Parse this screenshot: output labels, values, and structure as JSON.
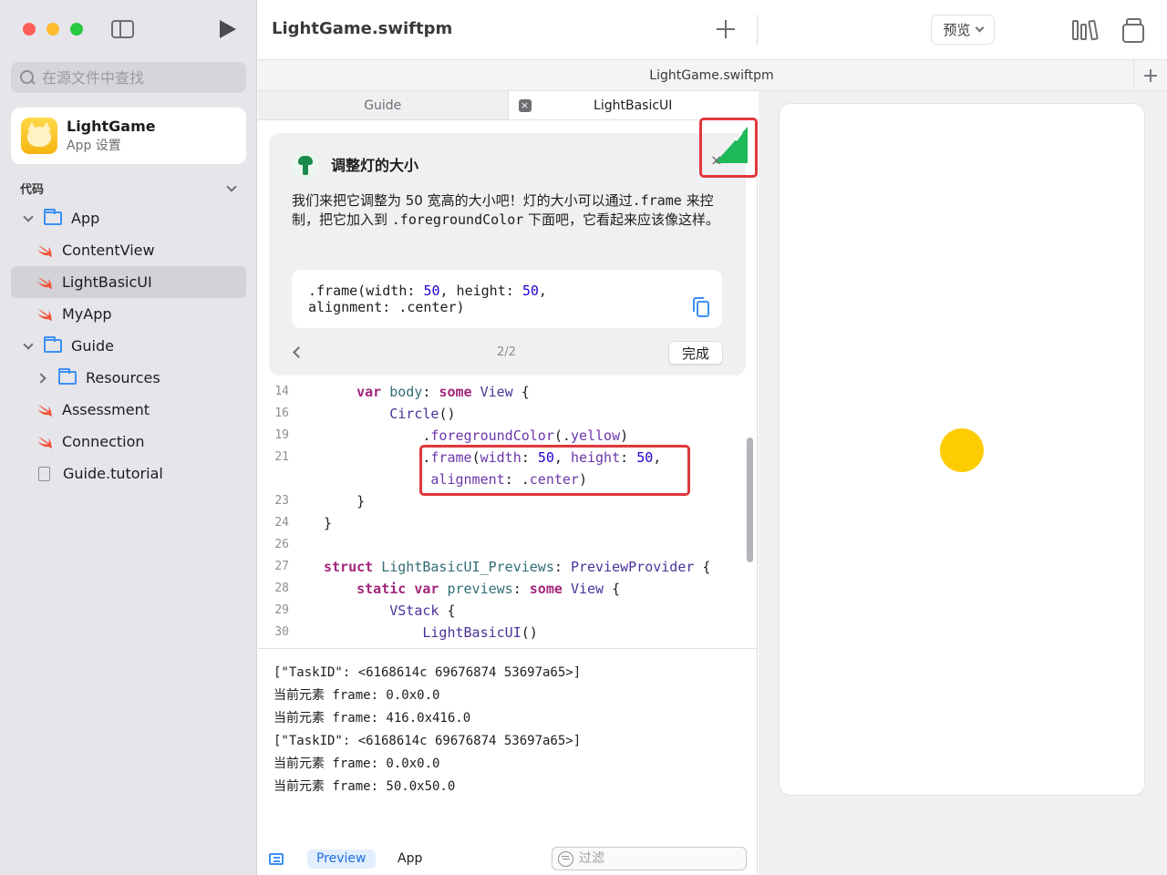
{
  "window": {
    "traffic_lights": {
      "close": "#fe5f57",
      "minimize": "#febc2e",
      "zoom": "#28c840"
    }
  },
  "sidebar": {
    "search_placeholder": "在源文件中查找",
    "app_card": {
      "name": "LightGame",
      "subtitle": "App 设置"
    },
    "section_title": "代码",
    "tree": [
      {
        "label": "App",
        "kind": "folder",
        "expanded": true
      },
      {
        "label": "ContentView",
        "kind": "swift"
      },
      {
        "label": "LightBasicUI",
        "kind": "swift",
        "selected": true
      },
      {
        "label": "MyApp",
        "kind": "swift"
      },
      {
        "label": "Guide",
        "kind": "folder",
        "expanded": true
      },
      {
        "label": "Resources",
        "kind": "folder",
        "expanded": false
      },
      {
        "label": "Assessment",
        "kind": "swift"
      },
      {
        "label": "Connection",
        "kind": "swift"
      },
      {
        "label": "Guide.tutorial",
        "kind": "document"
      }
    ]
  },
  "toolbar": {
    "project_title": "LightGame.swiftpm",
    "preview_menu_label": "预览",
    "icons": [
      "sidebar-toggle-icon",
      "run-icon",
      "plus-icon",
      "library-icon",
      "windows-icon"
    ]
  },
  "tabbar": {
    "title": "LightGame.swiftpm",
    "add_label": "+"
  },
  "editor": {
    "tabs": [
      {
        "label": "Guide",
        "active": false
      },
      {
        "label": "LightBasicUI",
        "active": true,
        "close": "×"
      }
    ],
    "guide": {
      "title": "调整灯的大小",
      "body_1": "我们来把它调整为 50 宽高的大小吧！灯的大小可以通过",
      "body_code_1": ".frame",
      "body_2": " 来控制，把它加入到 ",
      "body_code_2": ".foregroundColor",
      "body_3": " 下面吧，它看起来应该像这样。",
      "snippet_line_1_a": ".frame(width: ",
      "snippet_line_1_b": "50",
      "snippet_line_1_c": ", height: ",
      "snippet_line_1_d": "50",
      "snippet_line_1_e": ",",
      "snippet_line_2": "alignment: .center)",
      "page": "2/2",
      "done_label": "完成",
      "close_label": "×",
      "check_label": "✓",
      "badge_color": "#1fb95a"
    },
    "code_lines": [
      {
        "number": "14",
        "tokens": [
          [
            "    ",
            ""
          ],
          [
            "var",
            "kw"
          ],
          [
            " ",
            ""
          ],
          [
            "body",
            "fn"
          ],
          [
            ": ",
            ""
          ],
          [
            "some",
            "kw"
          ],
          [
            " ",
            ""
          ],
          [
            "View",
            "ty"
          ],
          [
            " {",
            ""
          ]
        ]
      },
      {
        "number": "16",
        "tokens": [
          [
            "        ",
            ""
          ],
          [
            "Circle",
            "ty"
          ],
          [
            "()",
            ""
          ]
        ]
      },
      {
        "number": "19",
        "tokens": [
          [
            "            .",
            ""
          ],
          [
            "foregroundColor",
            "mb"
          ],
          [
            "(.",
            ""
          ],
          [
            "yellow",
            "mb"
          ],
          [
            ")",
            ""
          ]
        ]
      },
      {
        "number": "21",
        "tokens": [
          [
            "            .",
            ""
          ],
          [
            "frame",
            "mb"
          ],
          [
            "(",
            ""
          ],
          [
            "width",
            "mb"
          ],
          [
            ": ",
            ""
          ],
          [
            "50",
            "num"
          ],
          [
            ", ",
            ""
          ],
          [
            "height",
            "mb"
          ],
          [
            ": ",
            ""
          ],
          [
            "50",
            "num"
          ],
          [
            ",",
            ""
          ]
        ]
      },
      {
        "number": "",
        "tokens": [
          [
            "             ",
            ""
          ],
          [
            "alignment",
            "mb"
          ],
          [
            ": .",
            ""
          ],
          [
            "center",
            "mb"
          ],
          [
            ")",
            ""
          ]
        ]
      },
      {
        "number": "23",
        "tokens": [
          [
            "    }",
            ""
          ]
        ]
      },
      {
        "number": "24",
        "tokens": [
          [
            "}",
            ""
          ]
        ]
      },
      {
        "number": "26",
        "tokens": []
      },
      {
        "number": "27",
        "tokens": [
          [
            "struct",
            "kw"
          ],
          [
            " ",
            ""
          ],
          [
            "LightBasicUI_Previews",
            "fn"
          ],
          [
            ": ",
            ""
          ],
          [
            "PreviewProvider",
            "ty"
          ],
          [
            " {",
            ""
          ]
        ]
      },
      {
        "number": "28",
        "tokens": [
          [
            "    ",
            ""
          ],
          [
            "static",
            "kw"
          ],
          [
            " ",
            ""
          ],
          [
            "var",
            "kw"
          ],
          [
            " ",
            ""
          ],
          [
            "previews",
            "fn"
          ],
          [
            ": ",
            ""
          ],
          [
            "some",
            "kw"
          ],
          [
            " ",
            ""
          ],
          [
            "View",
            "ty"
          ],
          [
            " {",
            ""
          ]
        ]
      },
      {
        "number": "29",
        "tokens": [
          [
            "        ",
            ""
          ],
          [
            "VStack",
            "ty"
          ],
          [
            " {",
            ""
          ]
        ]
      },
      {
        "number": "30",
        "tokens": [
          [
            "            ",
            ""
          ],
          [
            "LightBasicUI",
            "ty"
          ],
          [
            "()",
            ""
          ]
        ]
      }
    ],
    "console": [
      "[\"TaskID\": <6168614c 69676874 53697a65>]",
      "当前元素 frame: 0.0x0.0",
      "当前元素 frame: 416.0x416.0",
      "[\"TaskID\": <6168614c 69676874 53697a65>]",
      "当前元素 frame: 0.0x0.0",
      "当前元素 frame: 50.0x50.0"
    ],
    "bottom_bar": {
      "chips": [
        "Preview",
        "App"
      ],
      "filter_placeholder": "过滤"
    }
  },
  "preview": {
    "light_color": "#fecc03"
  }
}
